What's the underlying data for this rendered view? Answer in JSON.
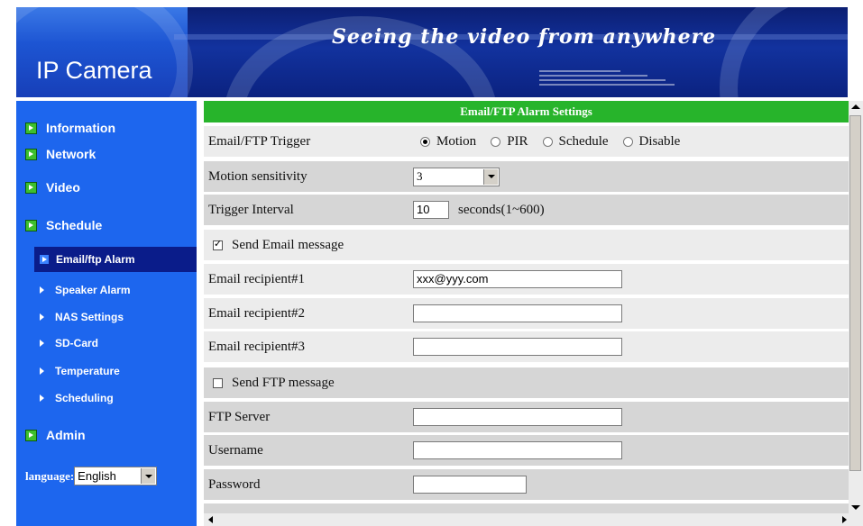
{
  "header": {
    "tagline": "Seeing the video from anywhere",
    "brand": "IP Camera"
  },
  "sidebar": {
    "items": [
      {
        "label": "Information"
      },
      {
        "label": "Network"
      },
      {
        "label": "Video"
      },
      {
        "label": "Schedule"
      },
      {
        "label": "Admin"
      }
    ],
    "schedule_sub": [
      {
        "label": "Email/ftp Alarm",
        "active": true
      },
      {
        "label": "Speaker Alarm"
      },
      {
        "label": "NAS Settings"
      },
      {
        "label": "SD-Card"
      },
      {
        "label": "Temperature"
      },
      {
        "label": "Scheduling"
      }
    ],
    "language": {
      "label": "language:",
      "value": "English"
    }
  },
  "form": {
    "title": "Email/FTP Alarm Settings",
    "trigger": {
      "label": "Email/FTP Trigger",
      "options": [
        "Motion",
        "PIR",
        "Schedule",
        "Disable"
      ],
      "selected": "Motion"
    },
    "sensitivity": {
      "label": "Motion sensitivity",
      "value": "3"
    },
    "interval": {
      "label": "Trigger Interval",
      "value": "10",
      "unit": "seconds(1~600)"
    },
    "send_email": {
      "label": "Send Email message",
      "checked": true
    },
    "recipients": [
      {
        "label": "Email recipient#1",
        "value": "xxx@yyy.com"
      },
      {
        "label": "Email recipient#2",
        "value": ""
      },
      {
        "label": "Email recipient#3",
        "value": ""
      }
    ],
    "send_ftp": {
      "label": "Send FTP message",
      "checked": false
    },
    "ftp_server": {
      "label": "FTP Server",
      "value": ""
    },
    "username": {
      "label": "Username",
      "value": ""
    },
    "password": {
      "label": "Password",
      "value": ""
    }
  },
  "colors": {
    "sidebar": "#1d66ee",
    "form_title": "#27b42b",
    "row_dark": "#d6d6d6",
    "row_light": "#ececec"
  }
}
